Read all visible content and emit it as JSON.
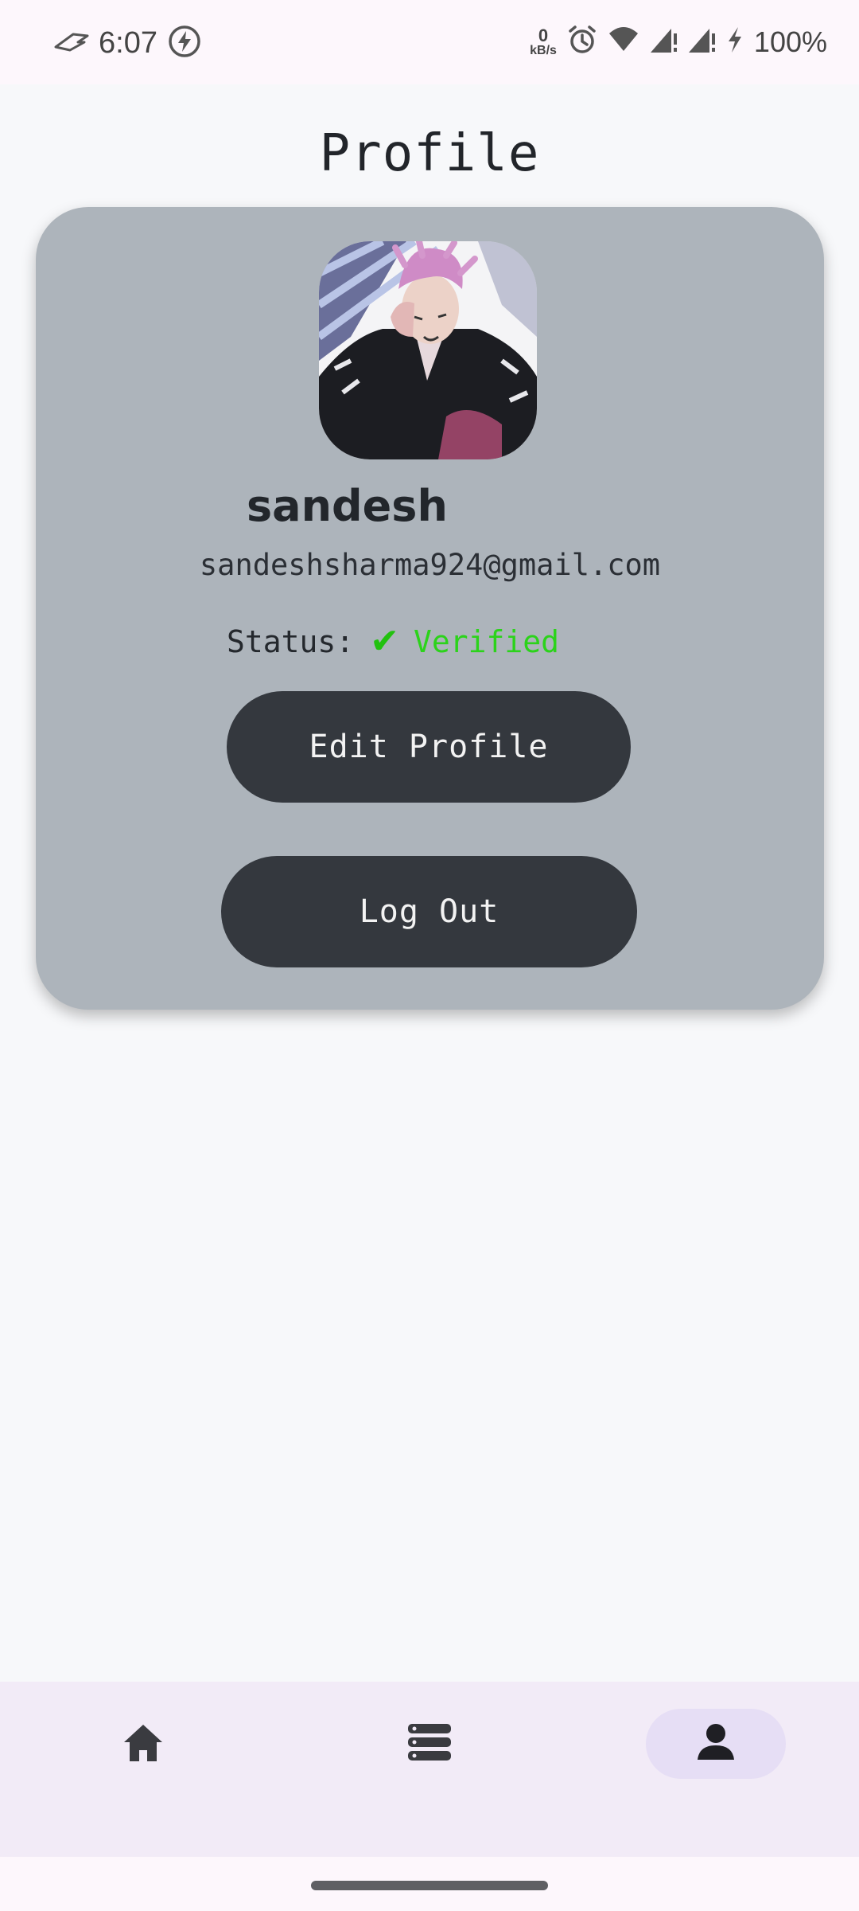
{
  "status_bar": {
    "time": "6:07",
    "net_speed_value": "0",
    "net_speed_unit": "kB/s",
    "battery": "100%",
    "icons": [
      "rog-logo-icon",
      "charging-bolt-icon",
      "alarm-icon",
      "wifi-icon",
      "signal-icon",
      "signal-icon",
      "battery-bolt-icon"
    ]
  },
  "page": {
    "title": "Profile"
  },
  "profile": {
    "username": "sandesh",
    "email": "sandeshsharma924@gmail.com",
    "status_label": "Status:",
    "status_icon": "✔",
    "status_value": "Verified",
    "status_color": "#2bd31a"
  },
  "actions": {
    "edit_label": "Edit Profile",
    "logout_label": "Log Out"
  },
  "bottom_nav": {
    "items": [
      {
        "icon": "home-icon",
        "active": false
      },
      {
        "icon": "list-icon",
        "active": false
      },
      {
        "icon": "person-icon",
        "active": true
      }
    ],
    "active_color": "#e6def5"
  }
}
